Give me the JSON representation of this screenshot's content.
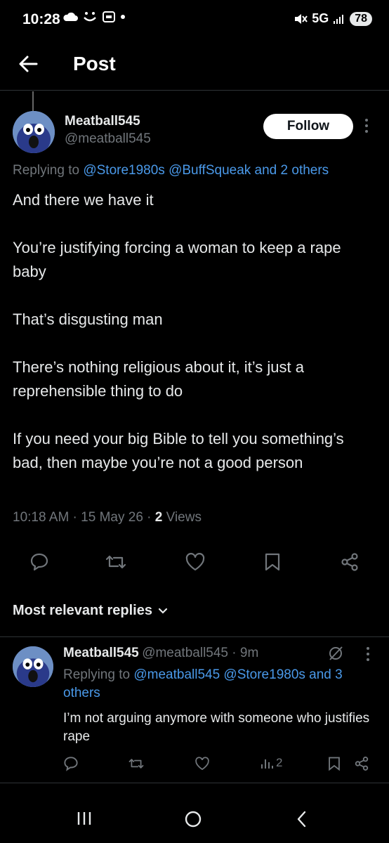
{
  "status_bar": {
    "time": "10:28",
    "network": "5G",
    "battery": "78"
  },
  "header": {
    "title": "Post"
  },
  "post": {
    "author_name": "Meatball545",
    "author_handle": "@meatball545",
    "follow_label": "Follow",
    "replying_prefix": "Replying to ",
    "replying_links": "@Store1980s @BuffSqueak and 2 others",
    "paragraphs": [
      "And there we have it",
      "You’re justifying forcing a woman to keep a rape baby",
      "That’s disgusting man",
      "There’s nothing religious about it, it’s just a reprehensible thing to do",
      "If you need your big Bible to tell you something’s bad, then maybe you’re not a good person"
    ],
    "timestamp": "10:18 AM · 15 May 26 · ",
    "views_count": "2",
    "views_label": " Views"
  },
  "replies_header": {
    "label": "Most relevant replies"
  },
  "reply": {
    "author_name": "Meatball545",
    "author_handle": "@meatball545 · 9m",
    "replying_prefix": "Replying to ",
    "replying_links": "@meatball545 @Store1980s and 3 others",
    "text": "I’m not arguing anymore with someone who justifies rape",
    "views_count": "2"
  },
  "colors": {
    "background": "#000000",
    "link": "#4a99e9",
    "muted": "#71767b",
    "text": "#e7e9ea"
  }
}
